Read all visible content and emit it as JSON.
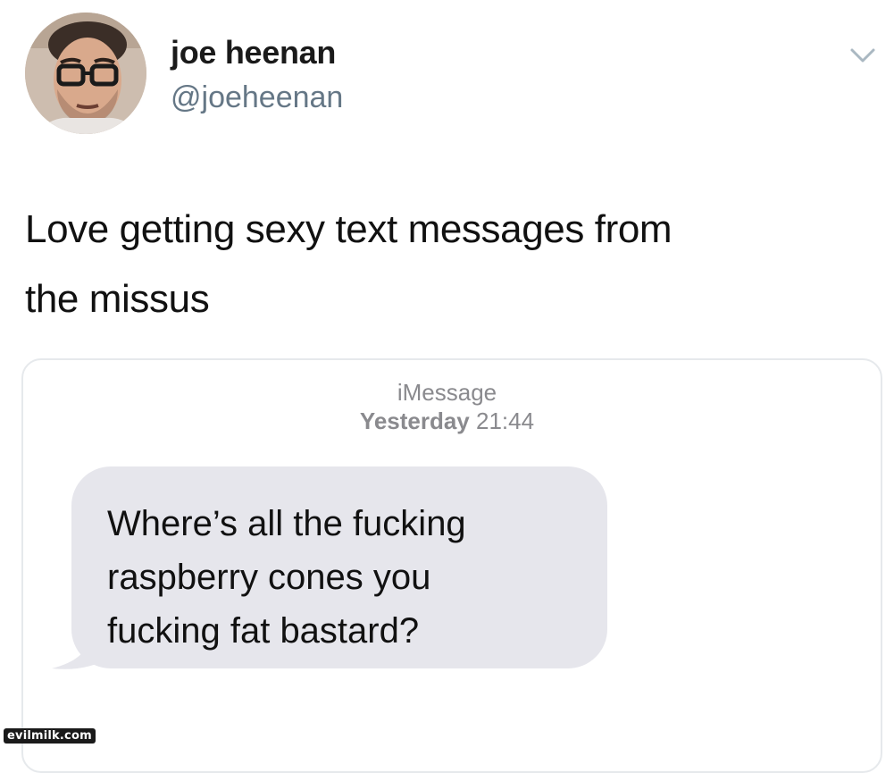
{
  "tweet": {
    "author": {
      "display_name": "joe heenan",
      "handle": "@joeheenan",
      "avatar_icon": "profile-photo"
    },
    "menu_icon": "chevron-down-icon",
    "text_lines": [
      "Love getting sexy text messages from",
      "the missus"
    ]
  },
  "imessage": {
    "service_label": "iMessage",
    "day_label": "Yesterday",
    "time_label": "21:44",
    "bubble_lines": [
      "Where’s all the fucking",
      "raspberry cones you",
      "fucking fat bastard?"
    ],
    "bubble_color": "#e6e6ec"
  },
  "watermark": "evilmilk.com",
  "colors": {
    "handle": "#657786",
    "timestamp": "#8a8a8e",
    "card_border": "#e6e9ec"
  }
}
